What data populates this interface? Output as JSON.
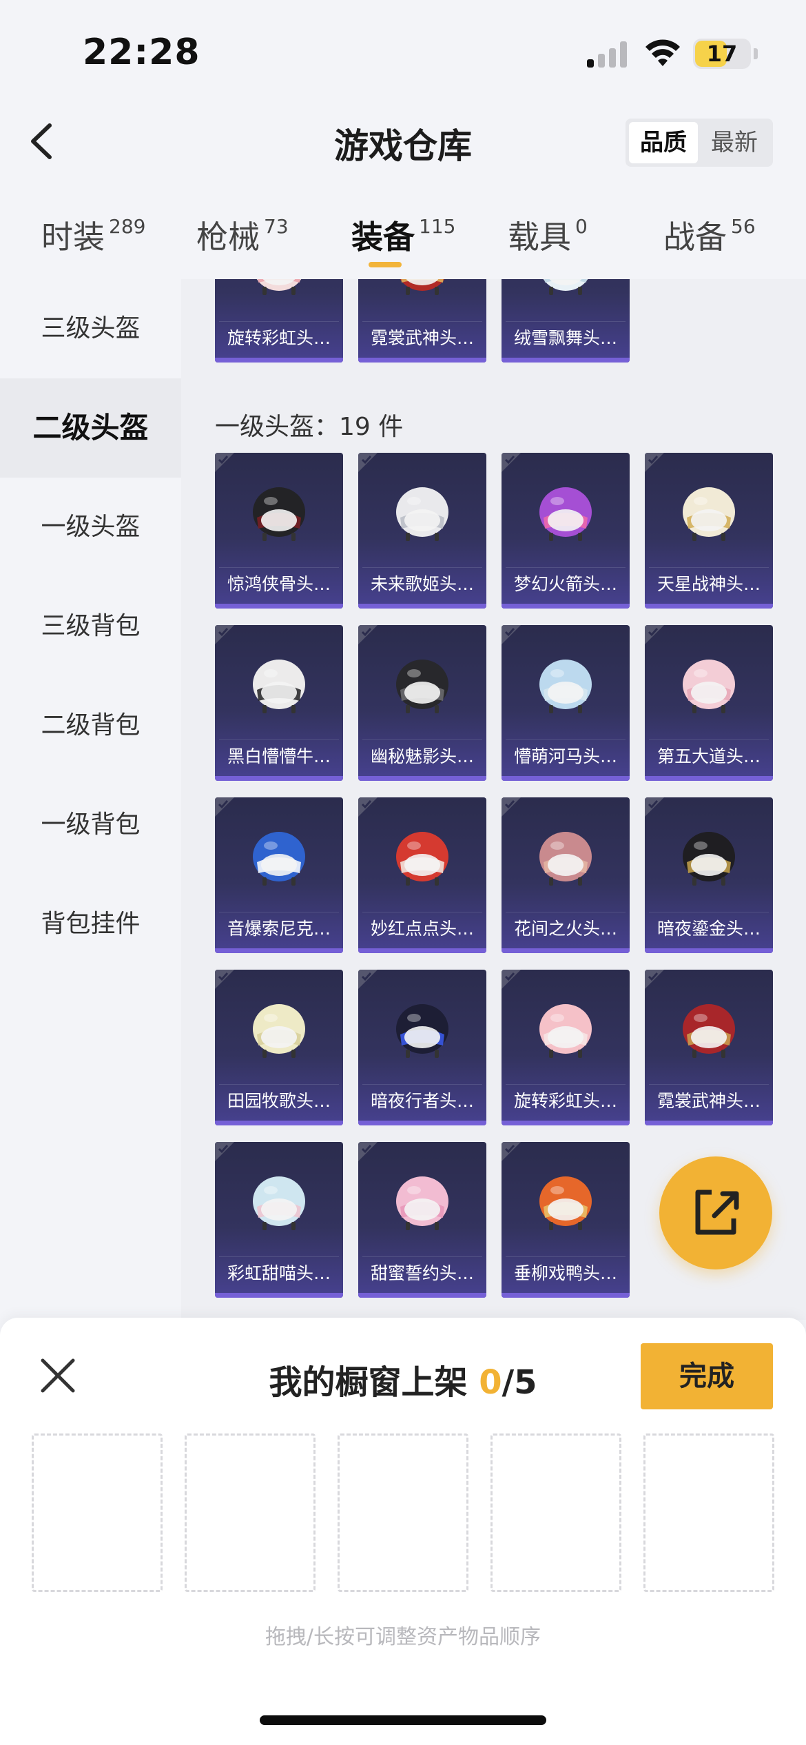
{
  "status_bar": {
    "time": "22:28",
    "battery": "17"
  },
  "header": {
    "title": "游戏仓库",
    "sort_options": [
      "品质",
      "最新"
    ]
  },
  "tabs": [
    {
      "label": "时装",
      "count": "289"
    },
    {
      "label": "枪械",
      "count": "73"
    },
    {
      "label": "装备",
      "count": "115"
    },
    {
      "label": "载具",
      "count": "0"
    },
    {
      "label": "战备",
      "count": "56"
    }
  ],
  "sidebar": {
    "items": [
      "三级头盔",
      "二级头盔",
      "一级头盔",
      "三级背包",
      "二级背包",
      "一级背包",
      "背包挂件"
    ],
    "active": "二级头盔"
  },
  "top_partial_row": [
    {
      "name": "旋转彩虹头…",
      "color": "#f3dcdc",
      "accent": "#e9a0a9"
    },
    {
      "name": "霓裳武神头…",
      "color": "#b12a27",
      "accent": "#e2b45c"
    },
    {
      "name": "绒雪飘舞头…",
      "color": "#e8f1f6",
      "accent": "#bcd5e3"
    }
  ],
  "section": {
    "label": "一级头盔：19 件"
  },
  "items": [
    {
      "name": "惊鸿侠骨头…",
      "color": "#232326",
      "accent": "#7b1f25"
    },
    {
      "name": "未来歌姬头…",
      "color": "#e9e9ec",
      "accent": "#b9bcc5"
    },
    {
      "name": "梦幻火箭头…",
      "color": "#a54fd4",
      "accent": "#f06aa8"
    },
    {
      "name": "天星战神头…",
      "color": "#f1ead6",
      "accent": "#d1ad55"
    },
    {
      "name": "黑白懵懵牛…",
      "color": "#ecebeb",
      "accent": "#222224"
    },
    {
      "name": "幽秘魅影头…",
      "color": "#28282c",
      "accent": "#6d6d72"
    },
    {
      "name": "懵萌河马头…",
      "color": "#bcd9ee",
      "accent": "#d7e6ef"
    },
    {
      "name": "第五大道头…",
      "color": "#f3cdd6",
      "accent": "#e6a7b7"
    },
    {
      "name": "音爆索尼克…",
      "color": "#2f63cf",
      "accent": "#ffffff"
    },
    {
      "name": "妙红点点头…",
      "color": "#d53a30",
      "accent": "#f2ece4"
    },
    {
      "name": "花间之火头…",
      "color": "#c98a8e",
      "accent": "#e5b6a3"
    },
    {
      "name": "暗夜鎏金头…",
      "color": "#1f1e22",
      "accent": "#c8a44d"
    },
    {
      "name": "田园牧歌头…",
      "color": "#eeeac6",
      "accent": "#d7cf9a"
    },
    {
      "name": "暗夜行者头…",
      "color": "#1d1e35",
      "accent": "#3b5cf0"
    },
    {
      "name": "旋转彩虹头…",
      "color": "#f5c1c8",
      "accent": "#f6e6e6"
    },
    {
      "name": "霓裳武神头…",
      "color": "#a8262a",
      "accent": "#caa250"
    },
    {
      "name": "彩虹甜喵头…",
      "color": "#cfe6f0",
      "accent": "#f0c3cf"
    },
    {
      "name": "甜蜜誓约头…",
      "color": "#f2bcd2",
      "accent": "#e795b9"
    },
    {
      "name": "垂柳戏鸭头…",
      "color": "#e6672a",
      "accent": "#e7c36a"
    }
  ],
  "showcase": {
    "title": "我的橱窗上架",
    "current": "0",
    "sep": "/",
    "max": "5",
    "done_label": "完成",
    "hint": "拖拽/长按可调整资产物品顺序"
  },
  "colors": {
    "accent": "#f2b234",
    "card_top": "#2b2c4d",
    "card_bottom": "#474190"
  }
}
